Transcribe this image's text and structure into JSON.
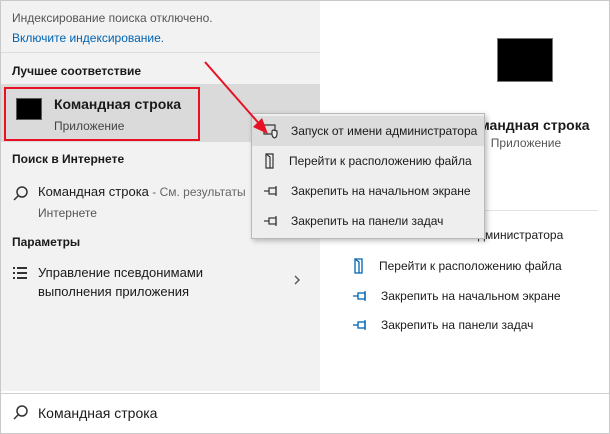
{
  "notice": {
    "text": "Индексирование поиска отключено.",
    "link": "Включите индексирование."
  },
  "best_match": {
    "heading": "Лучшее соответствие",
    "title": "Командная строка",
    "subtitle": "Приложение"
  },
  "web": {
    "heading": "Поиск в Интернете",
    "title": "Командная строка",
    "hint": " - См. результаты",
    "subtitle": "Интернете"
  },
  "settings": {
    "heading": "Параметры",
    "line1": "Управление псевдонимами",
    "line2": "выполнения приложения"
  },
  "context_menu": {
    "items": [
      {
        "label": "Запуск от имени администратора",
        "icon": "shield-icon"
      },
      {
        "label": "Перейти к расположению файла",
        "icon": "file-location-icon"
      },
      {
        "label": "Закрепить на начальном экране",
        "icon": "pin-icon"
      },
      {
        "label": "Закрепить на панели задач",
        "icon": "pin-icon"
      }
    ]
  },
  "preview": {
    "title": "Командная строка",
    "subtitle": "Приложение",
    "admin_fragment": "дминистратора",
    "actions": [
      {
        "label": "Перейти к расположению файла",
        "icon": "file-location-icon"
      },
      {
        "label": "Закрепить на начальном экране",
        "icon": "pin-icon"
      },
      {
        "label": "Закрепить на панели задач",
        "icon": "pin-icon"
      }
    ]
  },
  "search": {
    "value": "Командная строка"
  },
  "colors": {
    "accent": "#0063b1",
    "highlight_box": "#e81123",
    "arrow": "#e81123"
  }
}
